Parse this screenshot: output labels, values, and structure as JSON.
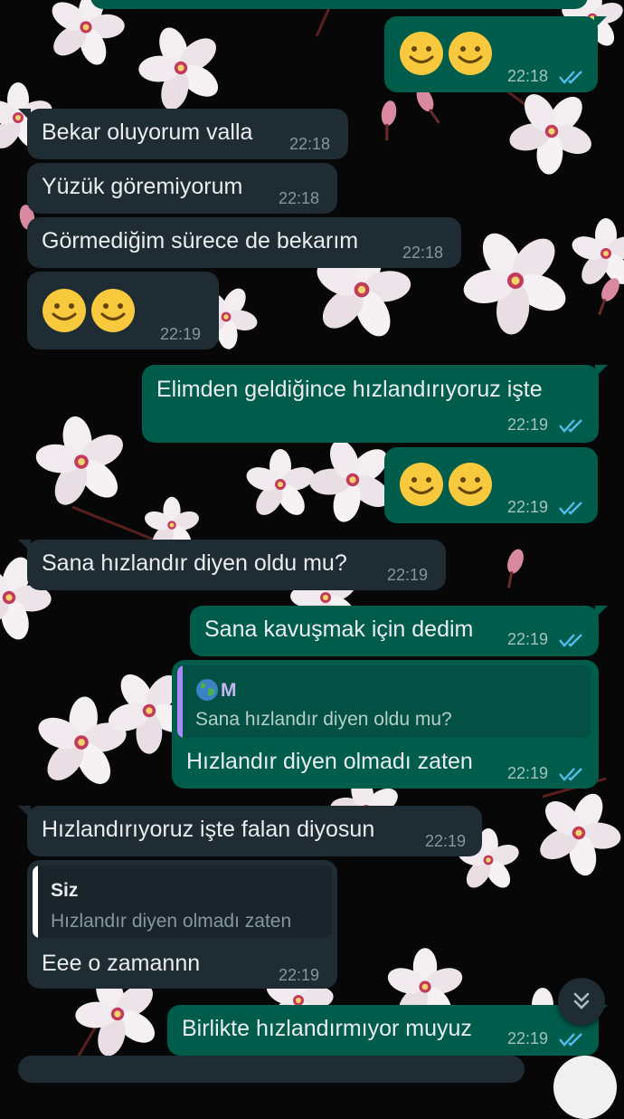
{
  "theme": {
    "accent": "#53bdeb",
    "incoming_bubble": "#1f2c33",
    "outgoing_bubble": "#005c4b",
    "quote_bar_incoming_reply": "#a78bfa",
    "quote_bar_outgoing_reply": "#ffffff"
  },
  "top_partial": {
    "time": "22:18"
  },
  "messages": [
    {
      "direction": "out",
      "emoji": [
        "slightly-smiling-face",
        "slightly-smiling-face"
      ],
      "time": "22:18",
      "status": "read-double-check-icon"
    },
    {
      "direction": "in",
      "text": "Bekar oluyorum valla",
      "time": "22:18"
    },
    {
      "direction": "in",
      "text": "Yüzük göremiyorum",
      "time": "22:18"
    },
    {
      "direction": "in",
      "text": "Görmediğim sürece de bekarım",
      "time": "22:18"
    },
    {
      "direction": "in",
      "emoji": [
        "slightly-smiling-face",
        "slightly-smiling-face"
      ],
      "time": "22:19"
    },
    {
      "direction": "out",
      "text": "Elimden geldiğince hızlandırıyoruz  işte",
      "time": "22:19",
      "status": "read-double-check-icon"
    },
    {
      "direction": "out",
      "emoji": [
        "slightly-smiling-face",
        "slightly-smiling-face"
      ],
      "time": "22:19",
      "status": "read-double-check-icon"
    },
    {
      "direction": "in",
      "text": "Sana hızlandır diyen oldu mu?",
      "time": "22:19"
    },
    {
      "direction": "out",
      "text": "Sana kavuşmak için dedim",
      "time": "22:19",
      "status": "read-double-check-icon"
    },
    {
      "direction": "out",
      "quote": {
        "author_icon": "globe-emoji",
        "author": "M",
        "text": "Sana hızlandır diyen oldu mu?"
      },
      "text": "Hızlandır diyen olmadı zaten",
      "time": "22:19",
      "status": "read-double-check-icon"
    },
    {
      "direction": "in",
      "text": "Hızlandırıyoruz işte falan diyosun",
      "time": "22:19"
    },
    {
      "direction": "in",
      "quote": {
        "author": "Siz",
        "text": "Hızlandır diyen olmadı zaten"
      },
      "text": "Eee o zamannn",
      "time": "22:19"
    },
    {
      "direction": "out",
      "text": "Birlikte hızlandırmıyor muyuz",
      "time": "22:19",
      "status": "read-double-check-icon"
    }
  ],
  "scroll_button": {
    "icon": "double-chevron-down-icon"
  }
}
